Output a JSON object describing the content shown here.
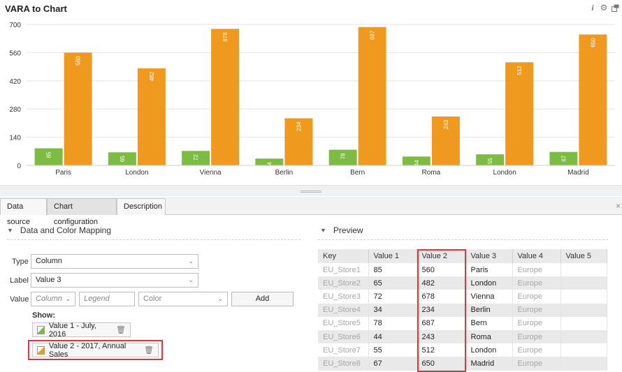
{
  "chart": {
    "title": "VARA to Chart",
    "icons": [
      "info-icon",
      "gear-icon",
      "window-icon"
    ]
  },
  "chart_data": {
    "type": "bar",
    "categories": [
      "Paris",
      "London",
      "Vienna",
      "Berlin",
      "Bern",
      "Roma",
      "London",
      "Madrid"
    ],
    "series": [
      {
        "values": [
          85,
          65,
          72,
          34,
          78,
          44,
          55,
          67
        ],
        "color": "#7dbc42"
      },
      {
        "values": [
          560,
          482,
          678,
          234,
          687,
          243,
          512,
          650
        ],
        "color": "#f0991f"
      }
    ],
    "ylim": [
      0,
      700
    ],
    "yticks": [
      0,
      140,
      280,
      420,
      560,
      700
    ],
    "grid": true,
    "data_labels": true,
    "legend": "none"
  },
  "tabs": [
    {
      "label": "Data source",
      "active": false
    },
    {
      "label": "Chart configuration",
      "active": true
    },
    {
      "label": "Description",
      "active": false
    }
  ],
  "mapping": {
    "title": "Data and Color Mapping",
    "type_label": "Type",
    "type_value": "Column",
    "label_label": "Label",
    "label_value": "Value 3",
    "value_label": "Value",
    "column_placeholder": "Column",
    "legend_placeholder": "Legend",
    "color_placeholder": "Color",
    "add_label": "Add",
    "show_label": "Show:",
    "show_items": [
      {
        "label": "Value 1 - July, 2016",
        "color": "#7dbc42"
      },
      {
        "label": "Value 2 - 2017, Annual Sales",
        "color": "#f0991f"
      }
    ]
  },
  "preview": {
    "title": "Preview",
    "columns": [
      "Key",
      "Value 1",
      "Value 2",
      "Value 3",
      "Value 4",
      "Value 5"
    ],
    "rows": [
      [
        "EU_Store1",
        "85",
        "560",
        "Paris",
        "Europe",
        ""
      ],
      [
        "EU_Store2",
        "65",
        "482",
        "London",
        "Europe",
        ""
      ],
      [
        "EU_Store3",
        "72",
        "678",
        "Vienna",
        "Europe",
        ""
      ],
      [
        "EU_Store4",
        "34",
        "234",
        "Berlin",
        "Europe",
        ""
      ],
      [
        "EU_Store5",
        "78",
        "687",
        "Bern",
        "Europe",
        ""
      ],
      [
        "EU_Store6",
        "44",
        "243",
        "Roma",
        "Europe",
        ""
      ],
      [
        "EU_Store7",
        "55",
        "512",
        "London",
        "Europe",
        ""
      ],
      [
        "EU_Store8",
        "67",
        "650",
        "Madrid",
        "Europe",
        ""
      ]
    ]
  },
  "colors": {
    "highlight": "#e0353b"
  }
}
